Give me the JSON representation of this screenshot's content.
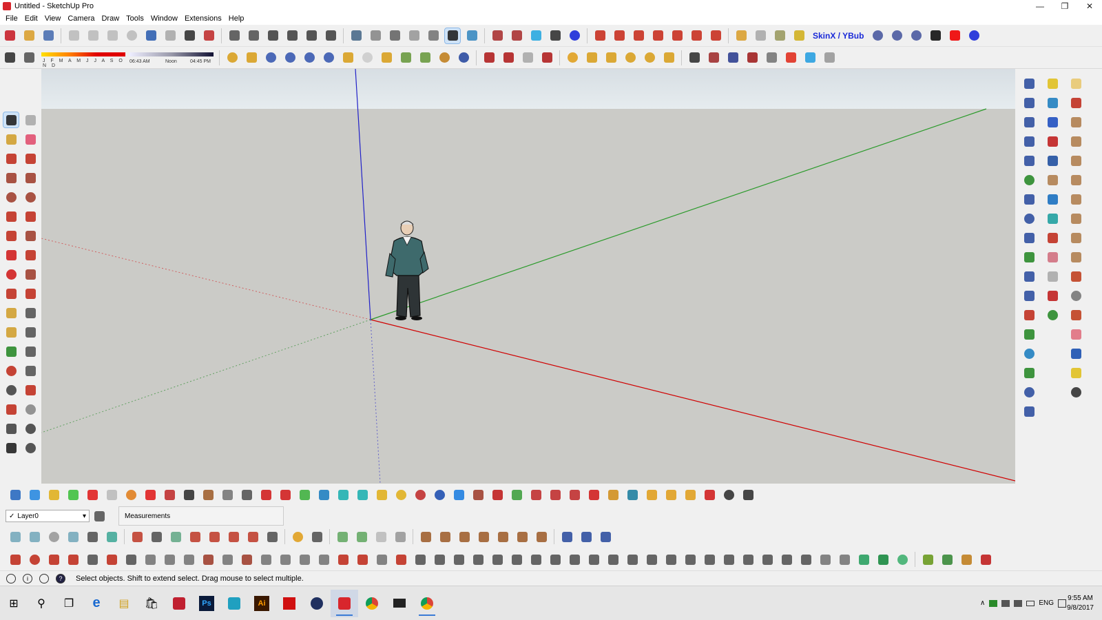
{
  "window": {
    "title": "Untitled - SketchUp Pro",
    "minimize": "—",
    "maximize": "❐",
    "close": "✕"
  },
  "menu": [
    "File",
    "Edit",
    "View",
    "Camera",
    "Draw",
    "Tools",
    "Window",
    "Extensions",
    "Help"
  ],
  "toolbar": {
    "skinx_label": "SkinX / YBub",
    "shadow": {
      "months": "J F M A M J J A S O N D",
      "sunrise": "06:43 AM",
      "noon": "Noon",
      "sunset": "04:45 PM"
    }
  },
  "layer": {
    "current": "Layer0",
    "check": "✓",
    "dropdown": "▾"
  },
  "measurements": {
    "label": "Measurements"
  },
  "status": {
    "message": "Select objects. Shift to extend select. Drag mouse to select multiple.",
    "info_icon": "i",
    "help_icon": "?"
  },
  "taskbar": {
    "start": "⊞",
    "search": "⚲",
    "taskview": "❐",
    "edge": "e",
    "explorer": "▤",
    "store": "🛍",
    "ps_label": "Ps",
    "ai_label": "Ai",
    "language": "ENG",
    "time": "9:55 AM",
    "date": "9/8/2017",
    "tray_up": "∧"
  },
  "colors": {
    "viewport_ground": "#cbcbc7",
    "axis_red": "#d00000",
    "axis_green": "#2a9a2a",
    "axis_blue": "#2020c8",
    "accent": "#3a7bd5"
  }
}
